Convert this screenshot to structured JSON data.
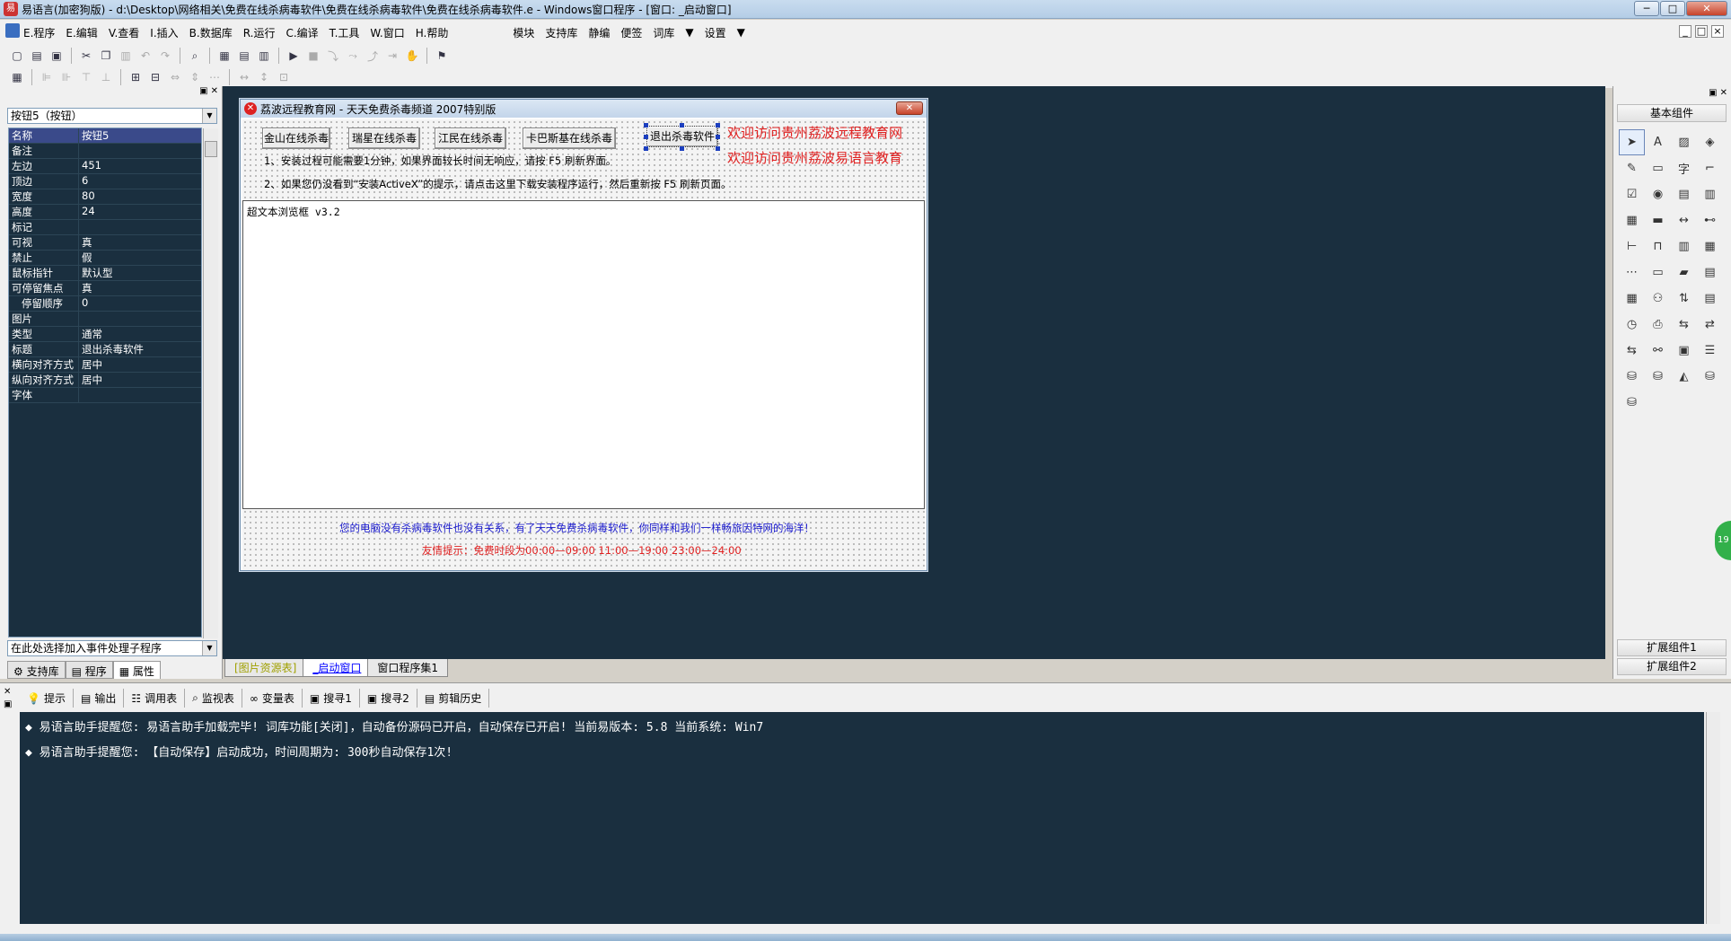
{
  "window": {
    "title": "易语言(加密狗版) - d:\\Desktop\\网络相关\\免费在线杀病毒软件\\免费在线杀病毒软件\\免费在线杀病毒软件.e - Windows窗口程序 - [窗口: _启动窗口]",
    "app_icon": "易",
    "controls": {
      "min": "─",
      "max": "□",
      "close": "✕"
    }
  },
  "menu": {
    "items": [
      "E.程序",
      "E.编辑",
      "V.查看",
      "I.插入",
      "B.数据库",
      "R.运行",
      "C.编译",
      "T.工具",
      "W.窗口",
      "H.帮助"
    ],
    "extras": [
      "模块",
      "支持库",
      "静编",
      "便签",
      "词库",
      "▼",
      "设置",
      "▼"
    ],
    "mdi": [
      "_",
      "□",
      "×"
    ]
  },
  "left_panel": {
    "object_selector": "按钮5（按钮）",
    "properties": [
      {
        "name": "名称",
        "value": "按钮5"
      },
      {
        "name": "备注",
        "value": ""
      },
      {
        "name": "左边",
        "value": "451"
      },
      {
        "name": "顶边",
        "value": "6"
      },
      {
        "name": "宽度",
        "value": "80"
      },
      {
        "name": "高度",
        "value": "24"
      },
      {
        "name": "标记",
        "value": ""
      },
      {
        "name": "可视",
        "value": "真"
      },
      {
        "name": "禁止",
        "value": "假"
      },
      {
        "name": "鼠标指针",
        "value": "默认型"
      },
      {
        "name": "可停留焦点",
        "value": "真"
      },
      {
        "name": "停留顺序",
        "value": "0"
      },
      {
        "name": "图片",
        "value": ""
      },
      {
        "name": "类型",
        "value": "通常"
      },
      {
        "name": "标题",
        "value": "退出杀毒软件"
      },
      {
        "name": "横向对齐方式",
        "value": "居中"
      },
      {
        "name": "纵向对齐方式",
        "value": "居中"
      },
      {
        "name": "字体",
        "value": ""
      }
    ],
    "event_selector": "在此处选择加入事件处理子程序",
    "tabs": [
      "支持库",
      "程序",
      "属性"
    ]
  },
  "designer": {
    "title": "荔波远程教育网 - 天天免费杀毒频道 2007特别版",
    "buttons": [
      "金山在线杀毒",
      "瑞星在线杀毒",
      "江民在线杀毒",
      "卡巴斯基在线杀毒",
      "退出杀毒软件"
    ],
    "red_line_1": "欢迎访问贵州荔波远程教育网",
    "red_line_2": "欢迎访问贵州荔波易语言教育",
    "note_1": "1、安装过程可能需要1分钟，如果界面较长时间无响应，请按 F5 刷新界面。",
    "note_2": "2、如果您仍没看到“安装ActiveX”的提示，请点击这里下载安装程序运行，然后重新按 F5 刷新页面。",
    "browser_text": "超文本浏览框 v3.2",
    "bottom_line_1": "您的电脑没有杀病毒软件也没有关系，有了天天免费杀病毒软件，你同样和我们一样畅旅因特网的海洋！",
    "bottom_line_2": "友情提示：免费时段为00:00—09:00 11:00—19:00 23:00—24:00",
    "colors": {
      "red": "#e02020",
      "blue": "#1a1acc"
    }
  },
  "right_panel": {
    "header": "基本组件",
    "footer_1": "扩展组件1",
    "footer_2": "扩展组件2",
    "badge": "19"
  },
  "doc_tabs": [
    "[图片资源表]",
    "_启动窗口",
    "窗口程序集1"
  ],
  "output": {
    "tabs": [
      "提示",
      "输出",
      "调用表",
      "监视表",
      "变量表",
      "搜寻1",
      "搜寻2",
      "剪辑历史"
    ],
    "lines": [
      "◆ 易语言助手提醒您:  易语言助手加载完毕! 词库功能[关闭]，自动备份源码已开启，自动保存已开启! 当前易版本: 5.8  当前系统: Win7",
      "◆ 易语言助手提醒您: 【自动保存】启动成功，时间周期为: 300秒自动保存1次!"
    ]
  }
}
